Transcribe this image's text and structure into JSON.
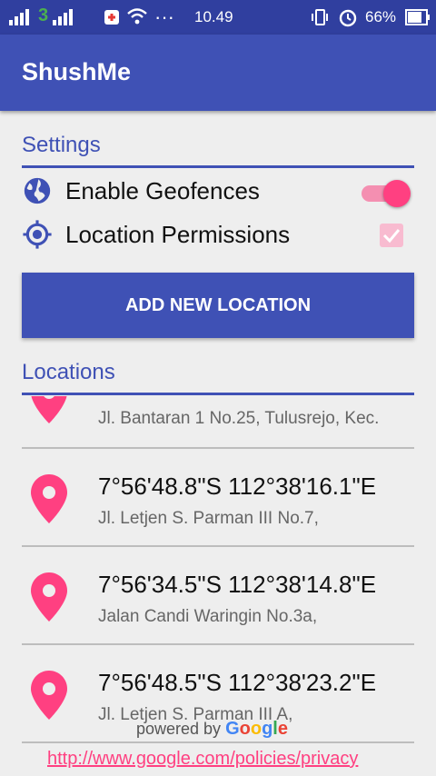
{
  "status_bar": {
    "time": "10.49",
    "battery": "66%",
    "carrier_glyph": "3",
    "dots": "···"
  },
  "app": {
    "title": "ShushMe"
  },
  "settings": {
    "header": "Settings",
    "enable_geofences_label": "Enable Geofences",
    "enable_geofences_on": true,
    "location_permissions_label": "Location Permissions",
    "location_permissions_checked": true
  },
  "add_button_label": "ADD NEW LOCATION",
  "locations": {
    "header": "Locations",
    "items": [
      {
        "title": "",
        "address": "Jl. Bantaran 1 No.25, Tulusrejo, Kec."
      },
      {
        "title": "7°56'48.8\"S 112°38'16.1\"E",
        "address": "Jl. Letjen S. Parman III No.7,"
      },
      {
        "title": "7°56'34.5\"S 112°38'14.8\"E",
        "address": "Jalan Candi Waringin No.3a,"
      },
      {
        "title": "7°56'48.5\"S 112°38'23.2\"E",
        "address": "Jl. Letjen S. Parman III A,"
      }
    ]
  },
  "footer": {
    "powered_by": "powered by",
    "google": "Google",
    "privacy_link": "http://www.google.com/policies/privacy"
  },
  "colors": {
    "primary": "#3f51b5",
    "primary_dark": "#303f9f",
    "accent": "#ff4081"
  }
}
